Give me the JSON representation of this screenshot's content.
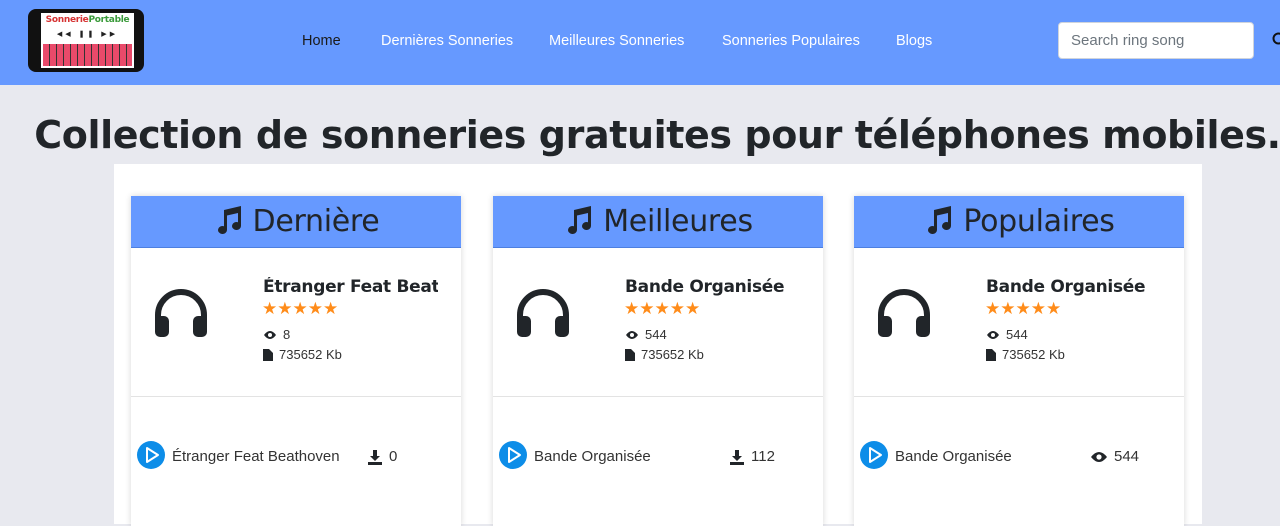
{
  "logo": {
    "text_a": "Sonnerie",
    "text_b": "Portable",
    "controls": "◀◀ ❚❚ ▶▶"
  },
  "nav": [
    {
      "label": "Home",
      "active": true
    },
    {
      "label": "Dernières Sonneries",
      "active": false
    },
    {
      "label": "Meilleures Sonneries",
      "active": false
    },
    {
      "label": "Sonneries Populaires",
      "active": false
    },
    {
      "label": "Blogs",
      "active": false
    }
  ],
  "search": {
    "placeholder": "Search ring song"
  },
  "headline": "Collection de sonneries gratuites pour téléphones mobiles.",
  "cards": [
    {
      "title": "Dernière",
      "song": "Étranger Feat Beathoven",
      "rating": "★★★★★",
      "views": "8",
      "size": "735652 Kb",
      "footer_title": "Étranger Feat Beathoven",
      "footer_stat_icon": "download-icon",
      "footer_stat": "0"
    },
    {
      "title": "Meilleures",
      "song": "Bande Organisée",
      "rating": "★★★★★",
      "views": "544",
      "size": "735652 Kb",
      "footer_title": "Bande Organisée",
      "footer_stat_icon": "download-icon",
      "footer_stat": "112"
    },
    {
      "title": "Populaires",
      "song": "Bande Organisée",
      "rating": "★★★★★",
      "views": "544",
      "size": "735652 Kb",
      "footer_title": "Bande Organisée",
      "footer_stat_icon": "eye-icon",
      "footer_stat": "544"
    }
  ],
  "colors": {
    "header": "#6699ff",
    "accent": "#0d8de8",
    "star": "#ff8c1a"
  }
}
